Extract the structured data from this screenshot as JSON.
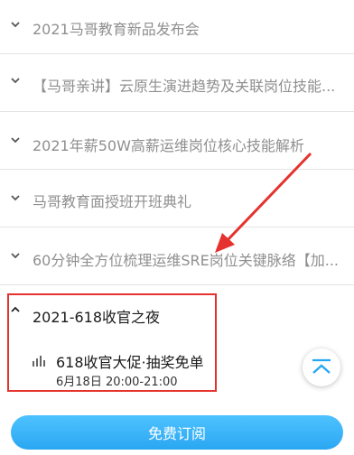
{
  "chapters": [
    {
      "title": "2021马哥教育新品发布会"
    },
    {
      "title": "【马哥亲讲】云原生演进趋势及关联岗位技能..."
    },
    {
      "title": "2021年薪50W高薪运维岗位核心技能解析"
    },
    {
      "title": "马哥教育面授班开班典礼"
    },
    {
      "title": "60分钟全方位梳理运维SRE岗位关键脉络【加..."
    },
    {
      "title": "2021-618收官之夜"
    }
  ],
  "lesson": {
    "title": "618收官大促·抽奖免单",
    "time": "6月18日 20:00-21:00"
  },
  "footer": {
    "subscribe_label": "免费订阅"
  },
  "colors": {
    "accent_blue": "#2aa7f2",
    "highlight_red": "#e5322e",
    "muted_text": "#8f8f8f"
  },
  "icons": {
    "collapsed": "chevron-down-icon",
    "expanded": "chevron-up-icon",
    "lesson": "audio-bars-icon",
    "back_to_top": "back-to-top-icon"
  }
}
